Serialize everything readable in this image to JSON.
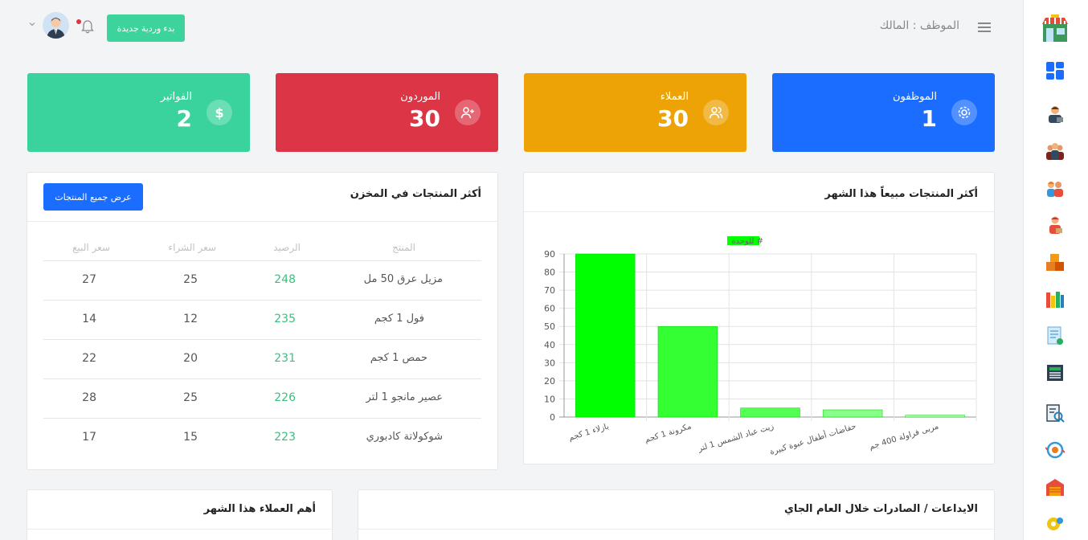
{
  "topbar": {
    "employee_label": "الموظف : المالك",
    "start_shift_button": "بدء وردية جديدة"
  },
  "stats": [
    {
      "label": "الموظفون",
      "value": "1",
      "color": "#1a6dff",
      "icon": "gear-icon"
    },
    {
      "label": "العملاء",
      "value": "30",
      "color": "#eda306",
      "icon": "users-icon"
    },
    {
      "label": "الموردون",
      "value": "30",
      "color": "#dc3545",
      "icon": "user-plus-icon"
    },
    {
      "label": "الفواتير",
      "value": "2",
      "color": "#3ad39e",
      "icon": "dollar-icon"
    }
  ],
  "stock_panel": {
    "title": "أكثر المنتجات في المخزن",
    "view_all_button": "عرض جميع المنتجات",
    "columns": [
      "المنتج",
      "الرصيد",
      "سعر الشراء",
      "سعر البيع"
    ],
    "rows": [
      {
        "product": "مزيل عرق 50 مل",
        "balance": "248",
        "buy": "25",
        "sell": "27"
      },
      {
        "product": "فول 1 كجم",
        "balance": "235",
        "buy": "12",
        "sell": "14"
      },
      {
        "product": "حمص 1 كجم",
        "balance": "231",
        "buy": "20",
        "sell": "22"
      },
      {
        "product": "عصير مانجو 1 لتر",
        "balance": "226",
        "buy": "25",
        "sell": "28"
      },
      {
        "product": "شوكولاتة كادبوري",
        "balance": "223",
        "buy": "15",
        "sell": "17"
      }
    ]
  },
  "best_sellers_panel": {
    "title": "أكثر المنتجات مبيعاً هذا الشهر"
  },
  "chart_data": {
    "type": "bar",
    "legend": "# للوحدة",
    "categories": [
      "بازلاء 1 كجم",
      "مكرونة 1 كجم",
      "زيت عباد الشمس 1 لتر",
      "حفاضات أطفال عبوة كبيرة",
      "مربى فراولة 400 جم"
    ],
    "values": [
      90,
      50,
      5,
      4,
      1
    ],
    "colors": [
      "#00ff00",
      "#33ff33",
      "#55ff55",
      "#88ff88",
      "#bbffbb"
    ],
    "ylim": [
      0,
      90
    ],
    "yticks": [
      "90",
      "80",
      "70",
      "60",
      "50",
      "40",
      "30",
      "20",
      "10",
      "0"
    ],
    "grid": true
  },
  "deposits_panel": {
    "title": "الايداعات / الصادرات خلال العام الجاي"
  },
  "top_customers_panel": {
    "title": "أهم العملاء هذا الشهر"
  },
  "sidebar": {
    "items": [
      "store-logo-icon",
      "dashboard-icon",
      "employee-icon",
      "group-icon",
      "clients-icon",
      "supplier-icon",
      "boxes-icon",
      "products-icon",
      "invoice-icon",
      "register-icon",
      "report-icon",
      "transfer-icon",
      "warehouse-icon",
      "settings-icon"
    ]
  }
}
